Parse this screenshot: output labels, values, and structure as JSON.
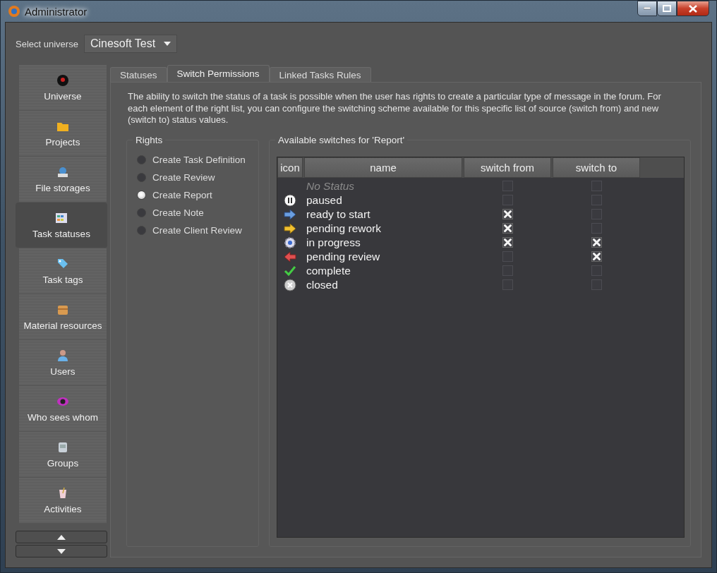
{
  "window": {
    "title": "Administrator"
  },
  "universe_select": {
    "label": "Select universe",
    "value": "Cinesoft Test"
  },
  "sidebar": {
    "items": [
      {
        "label": "Universe",
        "selected": false
      },
      {
        "label": "Projects",
        "selected": false
      },
      {
        "label": "File storages",
        "selected": false
      },
      {
        "label": "Task statuses",
        "selected": true
      },
      {
        "label": "Task tags",
        "selected": false
      },
      {
        "label": "Material resources",
        "selected": false
      },
      {
        "label": "Users",
        "selected": false
      },
      {
        "label": "Who sees whom",
        "selected": false
      },
      {
        "label": "Groups",
        "selected": false
      },
      {
        "label": "Activities",
        "selected": false
      }
    ]
  },
  "tabs": [
    {
      "label": "Statuses",
      "selected": false
    },
    {
      "label": "Switch Permissions",
      "selected": true
    },
    {
      "label": "Linked Tasks Rules",
      "selected": false
    }
  ],
  "description": "The ability to switch the status of a task is possible when the user has rights to create a particular type of message in the forum. For each element of the right list, you can configure the switching scheme available for this specific list of source (switch from) and new (switch to) status values.",
  "rights": {
    "title": "Rights",
    "items": [
      {
        "label": "Create Task Definition",
        "selected": false
      },
      {
        "label": "Create Review",
        "selected": false
      },
      {
        "label": "Create Report",
        "selected": true
      },
      {
        "label": "Create Note",
        "selected": false
      },
      {
        "label": "Create Client Review",
        "selected": false
      }
    ]
  },
  "switches": {
    "title": "Available switches for 'Report'",
    "columns": [
      "icon",
      "name",
      "switch from",
      "switch to"
    ],
    "rows": [
      {
        "kind": "placeholder",
        "name": "No Status",
        "switch_from": false,
        "switch_to": false
      },
      {
        "kind": "status",
        "name": "paused",
        "switch_from": false,
        "switch_to": false
      },
      {
        "kind": "status",
        "name": "ready to start",
        "switch_from": true,
        "switch_to": false
      },
      {
        "kind": "status",
        "name": "pending rework",
        "switch_from": true,
        "switch_to": false
      },
      {
        "kind": "status",
        "name": "in progress",
        "switch_from": true,
        "switch_to": true
      },
      {
        "kind": "status",
        "name": "pending review",
        "switch_from": false,
        "switch_to": true
      },
      {
        "kind": "status",
        "name": "complete",
        "switch_from": false,
        "switch_to": false
      },
      {
        "kind": "status",
        "name": "closed",
        "switch_from": false,
        "switch_to": false
      }
    ]
  }
}
